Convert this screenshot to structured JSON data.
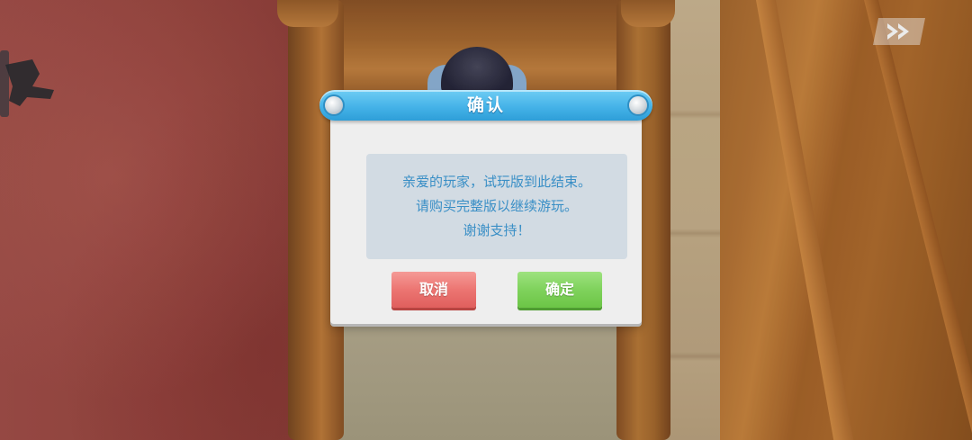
{
  "dialog": {
    "title": "确认",
    "message_lines": [
      "亲爱的玩家，试玩版到此结束。",
      "请购买完整版以继续游玩。",
      "谢谢支持！"
    ],
    "cancel_label": "取消",
    "confirm_label": "确定"
  },
  "icons": {
    "fast_forward": "fast-forward-icon",
    "camera": "camera-icon"
  },
  "colors": {
    "header_blue": "#45b3e8",
    "message_text": "#3a8fc6",
    "cancel_red": "#ec7572",
    "confirm_green": "#7fd25c",
    "dialog_bg": "#eeeeee"
  }
}
